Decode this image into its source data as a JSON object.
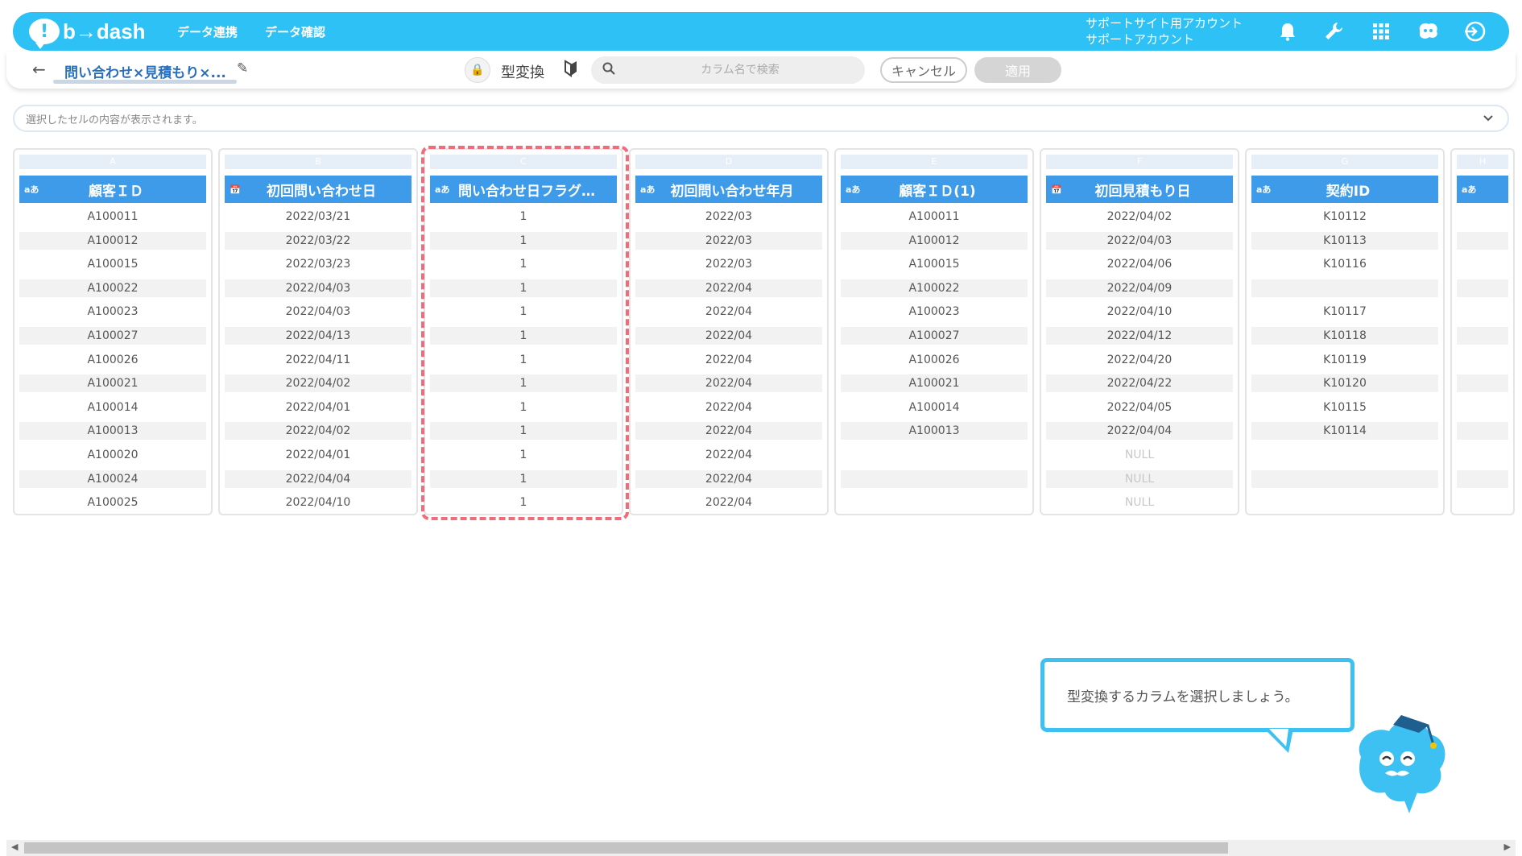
{
  "header": {
    "logo_text": "b→dash",
    "nav": [
      "データ連携",
      "データ確認"
    ],
    "account_line1": "サポートサイト用アカウント",
    "account_line2": "サポートアカウント"
  },
  "toolbar": {
    "back": "←",
    "workflow_name": "問い合わせ×見積もり×...",
    "mode_label": "型変換",
    "search_placeholder": "カラム名で検索",
    "cancel_label": "キャンセル",
    "apply_label": "適用"
  },
  "cellbar": {
    "placeholder": "選択したセルの内容が表示されます。"
  },
  "columns": [
    {
      "letter": "A",
      "type": "aあ",
      "title": "顧客ＩＤ",
      "cells": [
        "A100011",
        "A100012",
        "A100015",
        "A100022",
        "A100023",
        "A100027",
        "A100026",
        "A100021",
        "A100014",
        "A100013",
        "A100020",
        "A100024",
        "A100025"
      ]
    },
    {
      "letter": "B",
      "type": "📅",
      "title": "初回問い合わせ日",
      "cells": [
        "2022/03/21",
        "2022/03/22",
        "2022/03/23",
        "2022/04/03",
        "2022/04/03",
        "2022/04/13",
        "2022/04/11",
        "2022/04/02",
        "2022/04/01",
        "2022/04/02",
        "2022/04/01",
        "2022/04/04",
        "2022/04/10"
      ]
    },
    {
      "letter": "C",
      "type": "aあ",
      "title": "問い合わせ日フラグ…",
      "cells": [
        "1",
        "1",
        "1",
        "1",
        "1",
        "1",
        "1",
        "1",
        "1",
        "1",
        "1",
        "1",
        "1"
      ]
    },
    {
      "letter": "D",
      "type": "aあ",
      "title": "初回問い合わせ年月",
      "cells": [
        "2022/03",
        "2022/03",
        "2022/03",
        "2022/04",
        "2022/04",
        "2022/04",
        "2022/04",
        "2022/04",
        "2022/04",
        "2022/04",
        "2022/04",
        "2022/04",
        "2022/04"
      ]
    },
    {
      "letter": "E",
      "type": "aあ",
      "title": "顧客ＩＤ(1)",
      "cells": [
        "A100011",
        "A100012",
        "A100015",
        "A100022",
        "A100023",
        "A100027",
        "A100026",
        "A100021",
        "A100014",
        "A100013",
        "",
        "",
        ""
      ]
    },
    {
      "letter": "F",
      "type": "📅",
      "title": "初回見積もり日",
      "cells": [
        "2022/04/02",
        "2022/04/03",
        "2022/04/06",
        "2022/04/09",
        "2022/04/10",
        "2022/04/12",
        "2022/04/20",
        "2022/04/22",
        "2022/04/05",
        "2022/04/04",
        "NULL",
        "NULL",
        "NULL"
      ]
    },
    {
      "letter": "G",
      "type": "aあ",
      "title": "契約ID",
      "cells": [
        "K10112",
        "K10113",
        "K10116",
        "",
        "K10117",
        "K10118",
        "K10119",
        "K10120",
        "K10115",
        "K10114",
        "",
        "",
        ""
      ]
    },
    {
      "letter": "H",
      "type": "aあ",
      "title": "",
      "cells": [
        "",
        "",
        "",
        "",
        "",
        "",
        "",
        "",
        "",
        "",
        "",
        "",
        ""
      ]
    }
  ],
  "tooltip": {
    "text": "型変換するカラムを選択しましょう。"
  },
  "colors": {
    "brand": "#2ec1f5",
    "column_header": "#3d9be9",
    "highlight": "#f26b7a"
  }
}
